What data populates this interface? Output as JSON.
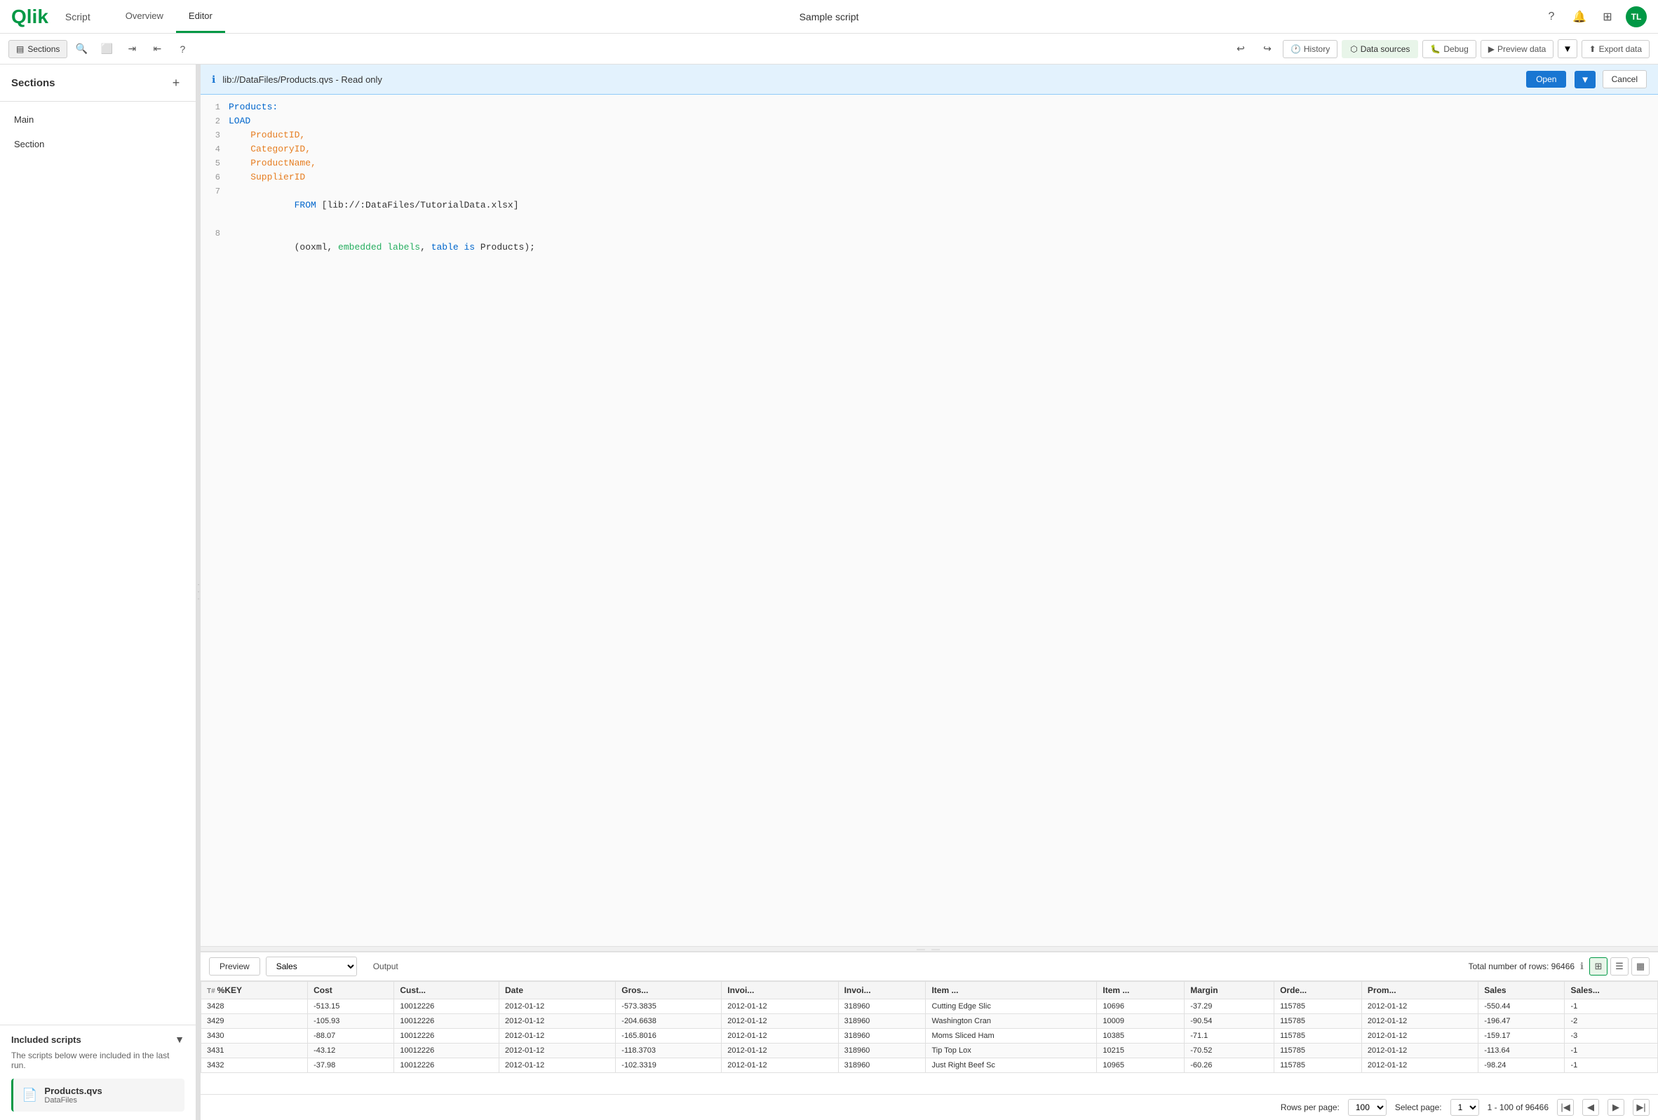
{
  "app": {
    "logo": "Qlik",
    "app_name": "Script",
    "nav_tabs": [
      {
        "label": "Overview",
        "active": false
      },
      {
        "label": "Editor",
        "active": true
      }
    ],
    "center_title": "Sample script"
  },
  "toolbar": {
    "sections_label": "Sections",
    "history_label": "History",
    "data_sources_label": "Data sources",
    "debug_label": "Debug",
    "preview_data_label": "Preview data",
    "export_data_label": "Export data"
  },
  "sidebar": {
    "title": "Sections",
    "sections": [
      {
        "label": "Main"
      },
      {
        "label": "Section"
      }
    ]
  },
  "included_scripts": {
    "title": "Included scripts",
    "description": "The scripts below were included in the last run.",
    "scripts": [
      {
        "name": "Products.qvs",
        "path": "DataFiles"
      }
    ]
  },
  "info_bar": {
    "text": "lib://DataFiles/Products.qvs - Read only",
    "open_label": "Open",
    "cancel_label": "Cancel"
  },
  "code": {
    "lines": [
      {
        "num": 1,
        "content": "Products:"
      },
      {
        "num": 2,
        "content": "LOAD"
      },
      {
        "num": 3,
        "content": "    ProductID,"
      },
      {
        "num": 4,
        "content": "    CategoryID,"
      },
      {
        "num": 5,
        "content": "    ProductName,"
      },
      {
        "num": 6,
        "content": "    SupplierID"
      },
      {
        "num": 7,
        "content": "FROM [lib://:DataFiles/TutorialData.xlsx]"
      },
      {
        "num": 8,
        "content": "(ooxml, embedded labels, table is Products);"
      }
    ]
  },
  "preview": {
    "label": "Preview",
    "table_select": "Sales",
    "output_label": "Output",
    "total_rows_label": "Total number of rows: 96466",
    "columns": [
      "%KEY",
      "Cost",
      "Cust...",
      "Date",
      "Gros...",
      "Invoi...",
      "Invoi...",
      "Item ...",
      "Item ...",
      "Margin",
      "Orde...",
      "Prom...",
      "Sales",
      "Sales..."
    ],
    "rows": [
      [
        "3428",
        "-513.15",
        "10012226",
        "2012-01-12",
        "-573.3835",
        "2012-01-12",
        "318960",
        "Cutting Edge Slic",
        "10696",
        "-37.29",
        "115785",
        "2012-01-12",
        "-550.44",
        "-1"
      ],
      [
        "3429",
        "-105.93",
        "10012226",
        "2012-01-12",
        "-204.6638",
        "2012-01-12",
        "318960",
        "Washington Cran",
        "10009",
        "-90.54",
        "115785",
        "2012-01-12",
        "-196.47",
        "-2"
      ],
      [
        "3430",
        "-88.07",
        "10012226",
        "2012-01-12",
        "-165.8016",
        "2012-01-12",
        "318960",
        "Moms Sliced Ham",
        "10385",
        "-71.1",
        "115785",
        "2012-01-12",
        "-159.17",
        "-3"
      ],
      [
        "3431",
        "-43.12",
        "10012226",
        "2012-01-12",
        "-118.3703",
        "2012-01-12",
        "318960",
        "Tip Top Lox",
        "10215",
        "-70.52",
        "115785",
        "2012-01-12",
        "-113.64",
        "-1"
      ],
      [
        "3432",
        "-37.98",
        "10012226",
        "2012-01-12",
        "-102.3319",
        "2012-01-12",
        "318960",
        "Just Right Beef Sc",
        "10965",
        "-60.26",
        "115785",
        "2012-01-12",
        "-98.24",
        "-1"
      ]
    ]
  },
  "pagination": {
    "rows_per_page_label": "Rows per page:",
    "rows_per_page_value": "100",
    "select_page_label": "Select page:",
    "select_page_value": "1",
    "range_label": "1 - 100 of 96466"
  }
}
